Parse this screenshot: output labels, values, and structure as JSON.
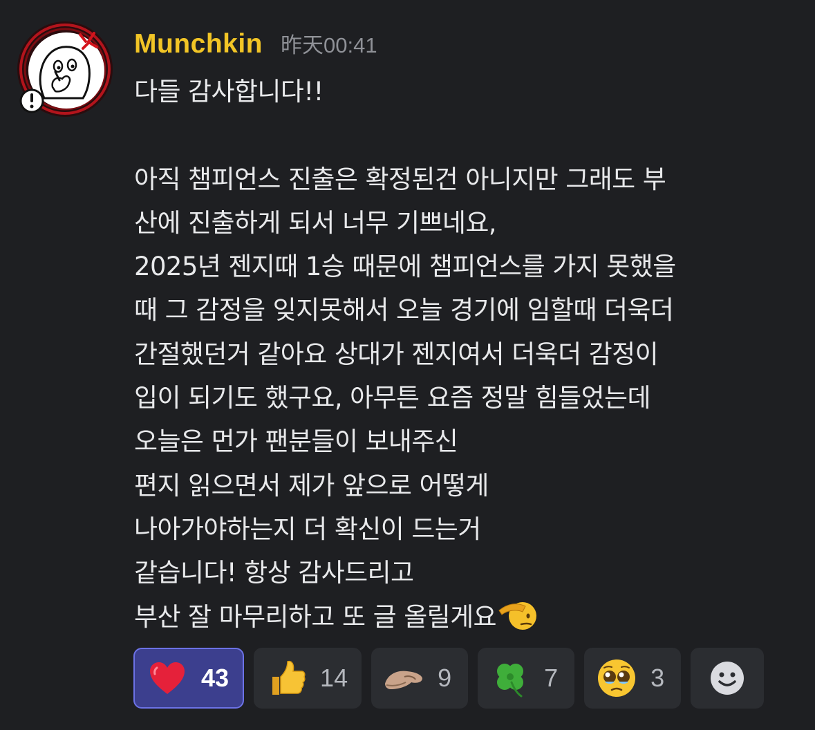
{
  "message": {
    "author": "Munchkin",
    "timestamp": "昨天00:41",
    "lines": [
      "다들 감사합니다!!",
      "",
      "아직 챔피언스 진출은 확정된건 아니지만 그래도 부",
      "산에 진출하게 되서 너무 기쁘네요,",
      "2025년 젠지때 1승 때문에 챔피언스를 가지 못했을",
      "때 그 감정을 잊지못해서 오늘 경기에 임할때 더욱더",
      "간절했던거 같아요 상대가 젠지여서 더욱더 감정이",
      "입이 되기도 했구요, 아무튼 요즘 정말 힘들었는데",
      "오늘은 먼가 팬분들이 보내주신",
      "편지 읽으면서 제가 앞으로 어떻게",
      "나아가야하는지 더 확신이 드는거",
      "같습니다! 항상 감사드리고",
      "부산 잘 마무리하고 또 글 올릴게요"
    ],
    "trailing_emoji": "saluting-face"
  },
  "reactions": [
    {
      "emoji": "heart",
      "count": "43",
      "active": true
    },
    {
      "emoji": "thumbs-up",
      "count": "14",
      "active": false
    },
    {
      "emoji": "custom-hand",
      "count": "9",
      "active": false
    },
    {
      "emoji": "four-leaf-clover",
      "count": "7",
      "active": false
    },
    {
      "emoji": "pleading-face",
      "count": "3",
      "active": false
    }
  ],
  "add_reaction_icon": "add-reaction-smiley",
  "colors": {
    "background": "#1e1f22",
    "username": "#f2c526",
    "timestamp": "#8f9197",
    "reaction_bg": "#2b2d31",
    "reaction_active_bg": "#3c3f8e",
    "reaction_active_border": "#6c72e6"
  }
}
